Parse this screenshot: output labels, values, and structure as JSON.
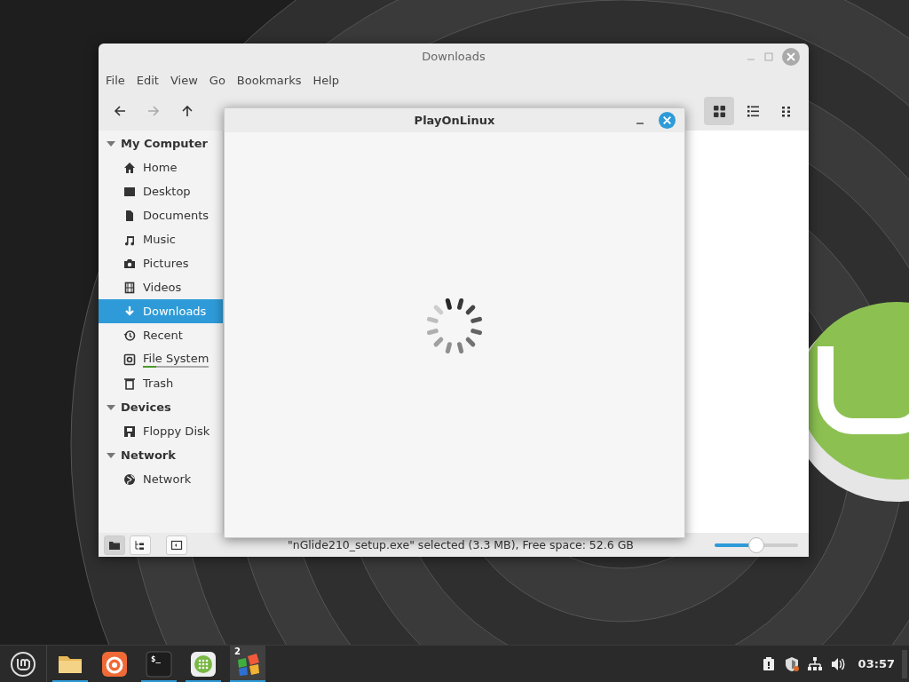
{
  "file_manager": {
    "title": "Downloads",
    "menu": [
      "File",
      "Edit",
      "View",
      "Go",
      "Bookmarks",
      "Help"
    ],
    "view_modes": [
      {
        "kind": "icons",
        "selected": true
      },
      {
        "kind": "list",
        "selected": false
      },
      {
        "kind": "compact",
        "selected": false
      }
    ],
    "sidebar": [
      {
        "heading": "My Computer",
        "expanded": true,
        "items": [
          {
            "label": "Home",
            "selected": false
          },
          {
            "label": "Desktop",
            "selected": false
          },
          {
            "label": "Documents",
            "selected": false
          },
          {
            "label": "Music",
            "selected": false
          },
          {
            "label": "Pictures",
            "selected": false
          },
          {
            "label": "Videos",
            "selected": false
          },
          {
            "label": "Downloads",
            "selected": true
          },
          {
            "label": "Recent",
            "selected": false
          },
          {
            "label": "File System",
            "selected": false,
            "level": 0.2
          },
          {
            "label": "Trash",
            "selected": false
          }
        ]
      },
      {
        "heading": "Devices",
        "expanded": true,
        "items": [
          {
            "label": "Floppy Disk",
            "selected": false
          }
        ]
      },
      {
        "heading": "Network",
        "expanded": true,
        "items": [
          {
            "label": "Network",
            "selected": false
          }
        ]
      }
    ],
    "status_bar": {
      "pane_buttons": [
        {
          "kind": "places",
          "selected": true
        },
        {
          "kind": "tree",
          "selected": false
        },
        {
          "kind": "sidebar",
          "selected": false
        }
      ],
      "text": "\"nGlide210_setup.exe\" selected (3.3 MB), Free space: 52.6 GB",
      "zoom": {
        "level": 0.5
      }
    }
  },
  "dialog": {
    "title": "PlayOnLinux"
  },
  "taskbar": {
    "apps": [
      {
        "kind": "files",
        "running": true,
        "selected": false
      },
      {
        "kind": "browser",
        "running": false,
        "selected": false
      },
      {
        "kind": "terminal",
        "label": "$_",
        "running": true,
        "selected": false
      },
      {
        "kind": "apps",
        "running": true,
        "selected": false
      },
      {
        "kind": "playonlinux",
        "badge": "2",
        "running": true,
        "selected": true
      }
    ],
    "clock": "03:57"
  }
}
